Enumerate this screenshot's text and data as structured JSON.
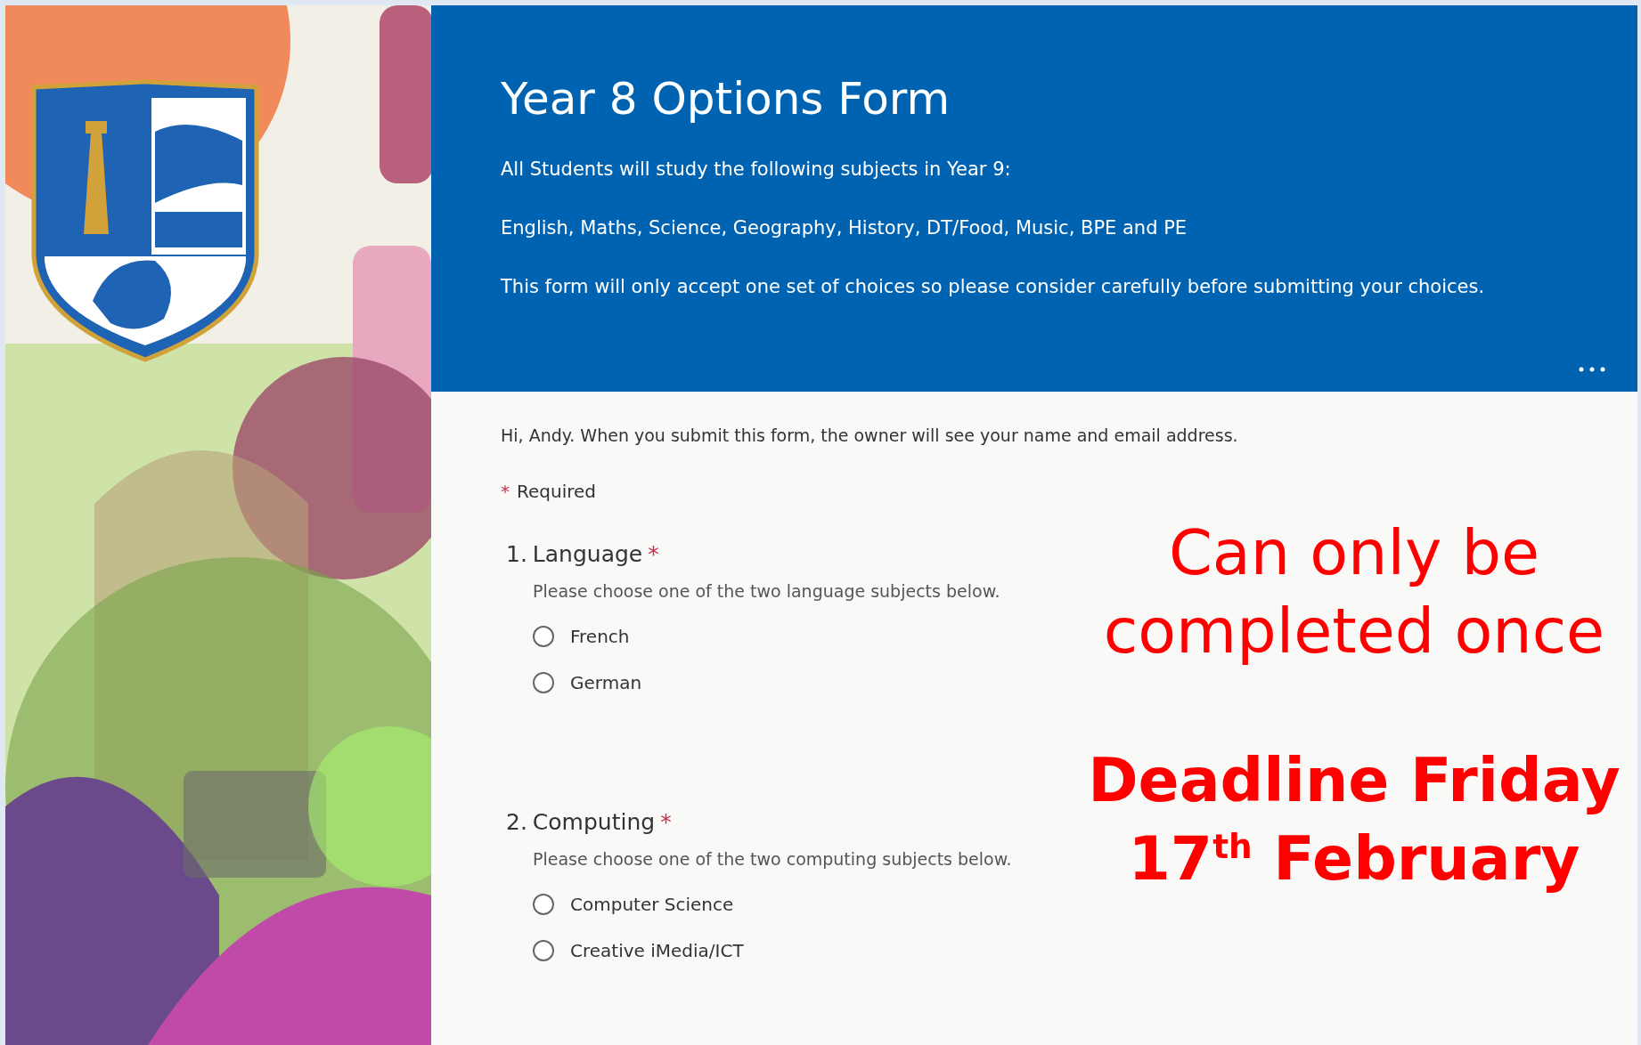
{
  "form": {
    "title": "Year 8 Options Form",
    "description": [
      "All Students will study the following subjects in Year 9:",
      "English, Maths, Science, Geography, History, DT/Food, Music, BPE and PE",
      "This form will only accept one set of choices so please consider carefully before submitting your choices."
    ]
  },
  "notice": "Hi, Andy. When you submit this form, the owner will see your name and email address.",
  "required_note": {
    "mark": "*",
    "label": "Required"
  },
  "questions": [
    {
      "number": "1.",
      "title": "Language",
      "required_mark": "*",
      "subtitle": "Please choose one of the two language subjects below.",
      "options": [
        {
          "label": "French",
          "selected": false
        },
        {
          "label": "German",
          "selected": false
        }
      ]
    },
    {
      "number": "2.",
      "title": "Computing",
      "required_mark": "*",
      "subtitle": "Please choose one of the two computing subjects below.",
      "options": [
        {
          "label": "Computer Science",
          "selected": false
        },
        {
          "label": "Creative iMedia/ICT",
          "selected": false
        }
      ]
    }
  ],
  "annotation": {
    "note": "Can only be completed once",
    "deadline": "Deadline Friday 17$^{th}$ February"
  }
}
